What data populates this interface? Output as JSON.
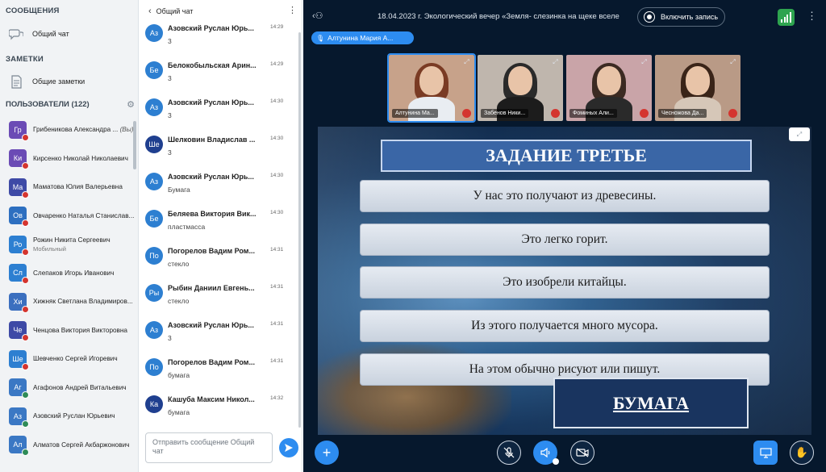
{
  "sidebar": {
    "messages_title": "СООБЩЕНИЯ",
    "chat_item": "Общий чат",
    "notes_title": "ЗАМЕТКИ",
    "notes_item": "Общие заметки",
    "users_title": "ПОЛЬЗОВАТЕЛИ (122)",
    "users": [
      {
        "initials": "Гр",
        "name": "Грибеникова Александра ...",
        "suffix": "(Вы)",
        "color": "#6b4bb5",
        "badge": "red"
      },
      {
        "initials": "Ки",
        "name": "Кирсенко Николай Николаевич",
        "color": "#6b4bb5",
        "badge": "red"
      },
      {
        "initials": "Ма",
        "name": "Маматова Юлия Валерьевна",
        "color": "#3e4aa6",
        "badge": "red"
      },
      {
        "initials": "Ов",
        "name": "Овчаренко Наталья Станислав...",
        "color": "#2d6fc0",
        "badge": "red"
      },
      {
        "initials": "Ро",
        "name": "Рожин Никита Сергеевич",
        "sub": "Мобильный",
        "color": "#2d7fd1",
        "badge": "red"
      },
      {
        "initials": "Сл",
        "name": "Слепаков Игорь Иванович",
        "color": "#2d7fd1",
        "badge": "red"
      },
      {
        "initials": "Хи",
        "name": "Хижняк Светлана Владимиров...",
        "color": "#3b6fbf",
        "badge": "red"
      },
      {
        "initials": "Че",
        "name": "Ченцова Виктория Викторовна",
        "color": "#3e4aa6",
        "badge": "red"
      },
      {
        "initials": "Ше",
        "name": "Шевченко Сергей Игоревич",
        "color": "#2d7fd1",
        "badge": "red"
      },
      {
        "initials": "Аг",
        "name": "Агафонов Андрей Витальевич",
        "color": "#3b78c4",
        "badge": "green"
      },
      {
        "initials": "Аз",
        "name": "Азовский Руслан Юрьевич",
        "color": "#3b78c4",
        "badge": "green"
      },
      {
        "initials": "Ал",
        "name": "Алматов Сергей Акбаржонович",
        "color": "#3b78c4",
        "badge": "green"
      }
    ]
  },
  "chat": {
    "back_title": "Общий чат",
    "input_placeholder": "Отправить сообщение Общий чат",
    "messages": [
      {
        "initials": "Аз",
        "name": "Азовский Руслан Юрь...",
        "time": "14:29",
        "text": "3",
        "color": "#2d7fd1"
      },
      {
        "initials": "Бе",
        "name": "Белокобыльская Арин...",
        "time": "14:29",
        "text": "3",
        "color": "#2d7fd1"
      },
      {
        "initials": "Аз",
        "name": "Азовский Руслан Юрь...",
        "time": "14:30",
        "text": "3",
        "color": "#2d7fd1"
      },
      {
        "initials": "Ше",
        "name": "Шелковин Владислав ...",
        "time": "14:30",
        "text": "3",
        "color": "#1f3f8f"
      },
      {
        "initials": "Аз",
        "name": "Азовский Руслан Юрь...",
        "time": "14:30",
        "text": "Бумага",
        "color": "#2d7fd1"
      },
      {
        "initials": "Бе",
        "name": "Беляева Виктория Вик...",
        "time": "14:30",
        "text": "пластмасса",
        "color": "#2d7fd1"
      },
      {
        "initials": "По",
        "name": "Погорелов Вадим Ром...",
        "time": "14:31",
        "text": "стекло",
        "color": "#2d7fd1"
      },
      {
        "initials": "Ры",
        "name": "Рыбин Даниил Евгень...",
        "time": "14:31",
        "text": "стекло",
        "color": "#2d7fd1"
      },
      {
        "initials": "Аз",
        "name": "Азовский Руслан Юрь...",
        "time": "14:31",
        "text": "3",
        "color": "#2d7fd1"
      },
      {
        "initials": "По",
        "name": "Погорелов Вадим Ром...",
        "time": "14:31",
        "text": "бумага",
        "color": "#2d7fd1"
      },
      {
        "initials": "Ка",
        "name": "Кашуба Максим Никол...",
        "time": "14:32",
        "text": "бумага",
        "color": "#1f3f8f"
      }
    ]
  },
  "main": {
    "title": "18.04.2023 г. Экологический вечер «Земля- слезинка на щеке вселе",
    "record_label": "Включить запись",
    "speaker": "Алтунина Мария А...",
    "thumbnails": [
      {
        "name": "Алтунина Ма...",
        "hair": "#7a3b24",
        "body": "#e9edf2",
        "bg": "#c7a28a",
        "active": true
      },
      {
        "name": "Забенов Ники...",
        "hair": "#2a2a2a",
        "body": "#1c1c1c",
        "bg": "#bfb6ad",
        "active": false
      },
      {
        "name": "Фоминых Али...",
        "hair": "#3b2a22",
        "body": "#2a2a2a",
        "bg": "#c9a4a8",
        "active": false
      },
      {
        "name": "Чесножова Да...",
        "hair": "#3a2418",
        "body": "#d6c7b8",
        "bg": "#b99a86",
        "active": false
      }
    ],
    "slide": {
      "title": "ЗАДАНИЕ ТРЕТЬЕ",
      "clues": [
        "У нас это получают из древесины.",
        "Это легко горит.",
        "Это изобрели китайцы.",
        "Из этого получается много мусора.",
        "На этом обычно рисуют или пишут."
      ],
      "answer": "БУМАГА"
    }
  }
}
